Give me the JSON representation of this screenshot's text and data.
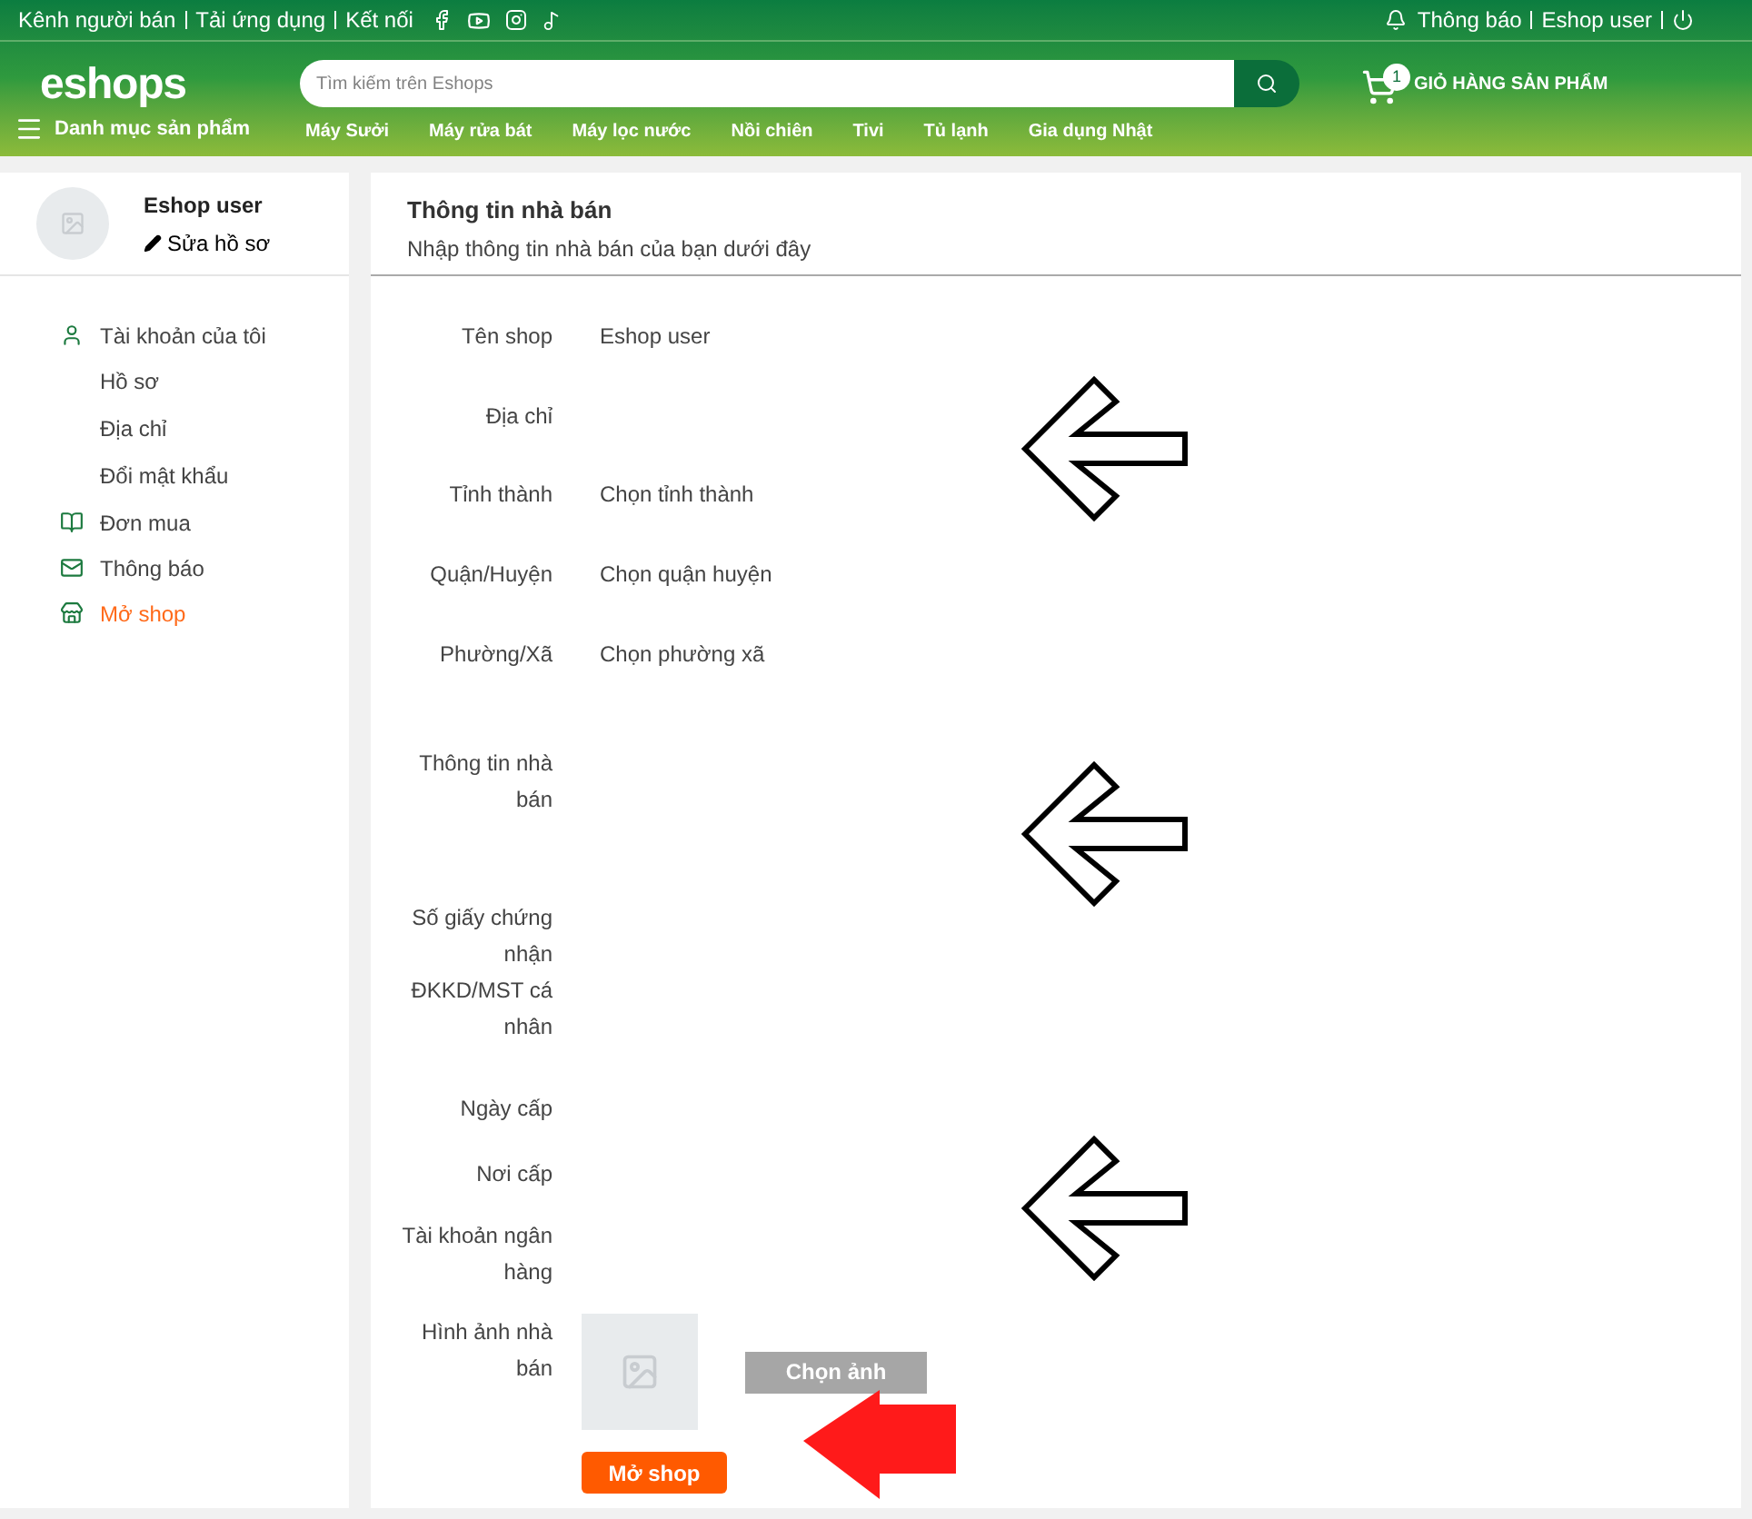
{
  "top_bar": {
    "links": [
      "Kênh người bán",
      "Tải ứng dụng",
      "Kết nối"
    ],
    "notifications": "Thông báo",
    "user": "Eshop user"
  },
  "header": {
    "logo": "eshops",
    "search": {
      "placeholder": "Tìm kiếm trên Eshops"
    },
    "cart": {
      "count": "1",
      "label": "GIỎ HÀNG SẢN PHẨM"
    },
    "menu_label": "Danh mục sản phẩm",
    "categories": [
      "Máy Sưởi",
      "Máy rửa bát",
      "Máy lọc nước",
      "Nồi chiên",
      "Tivi",
      "Tủ lạnh",
      "Gia dụng Nhật"
    ]
  },
  "sidebar": {
    "user_name": "Eshop user",
    "edit_profile": "Sửa hồ sơ",
    "items": [
      {
        "label": "Tài khoản của tôi",
        "selected": false,
        "children": [
          {
            "label": "Hồ sơ",
            "selected": false
          },
          {
            "label": "Địa chỉ",
            "selected": false
          },
          {
            "label": "Đổi mật khẩu",
            "selected": false
          }
        ]
      },
      {
        "label": "Đơn mua",
        "selected": false
      },
      {
        "label": "Thông báo",
        "selected": false
      },
      {
        "label": "Mở shop",
        "selected": true
      }
    ]
  },
  "form": {
    "title": "Thông tin nhà bán",
    "subtitle": "Nhập thông tin nhà bán của bạn dưới đây",
    "fields": [
      {
        "kind": "text",
        "label": "Tên shop",
        "value": "Eshop user"
      },
      {
        "kind": "text",
        "label": "Địa chỉ"
      },
      {
        "kind": "select",
        "label": "Tỉnh thành",
        "placeholder": "Chọn tỉnh thành"
      },
      {
        "kind": "select",
        "label": "Quận/Huyện",
        "placeholder": "Chọn quận huyện"
      },
      {
        "kind": "select",
        "label": "Phường/Xã",
        "placeholder": "Chọn phường xã"
      },
      {
        "kind": "text",
        "label": "Thông tin nhà bán"
      },
      {
        "kind": "text",
        "label": "Số giấy chứng nhận ĐKKD/MST cá nhân"
      },
      {
        "kind": "text",
        "label": "Ngày cấp"
      },
      {
        "kind": "text",
        "label": "Nơi cấp"
      },
      {
        "kind": "text",
        "label": "Tài khoản ngân hàng"
      },
      {
        "kind": "image",
        "label": "Hình ảnh nhà bán",
        "button": "Chọn ảnh"
      }
    ],
    "submit": "Mở shop"
  },
  "annotations": [
    {
      "kind": "outline",
      "color": "#000000"
    },
    {
      "kind": "outline",
      "color": "#000000"
    },
    {
      "kind": "outline",
      "color": "#000000"
    },
    {
      "kind": "solid",
      "color": "#ff1a1a"
    }
  ]
}
